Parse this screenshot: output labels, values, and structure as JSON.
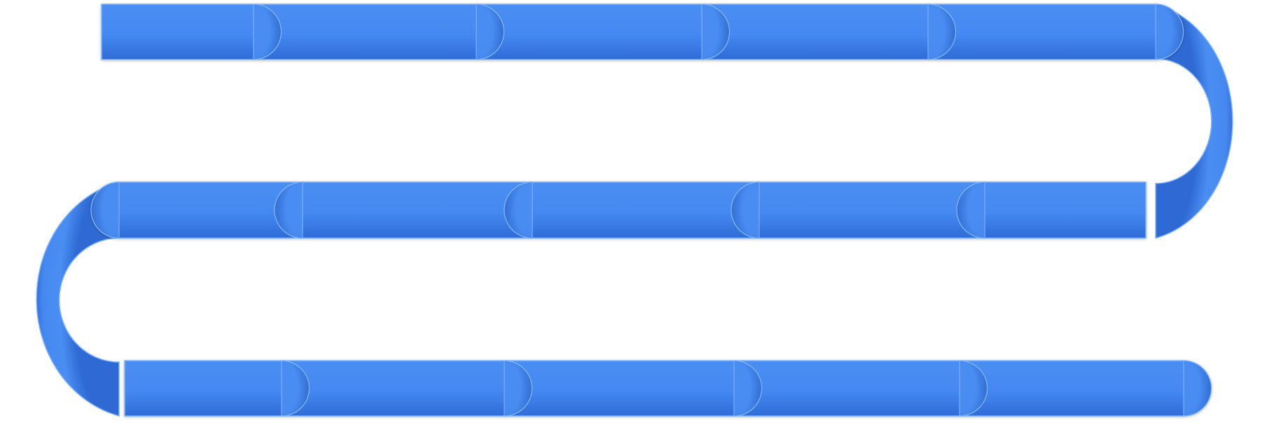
{
  "diagram": {
    "kind": "serpentine-segmented-path",
    "rows": [
      {
        "segments": 5,
        "direction": "left-to-right",
        "start_cap": "flat",
        "end_cap": "round"
      },
      {
        "segments": 5,
        "direction": "right-to-left",
        "start_cap": "flat",
        "end_cap": "round"
      },
      {
        "segments": 5,
        "direction": "left-to-right",
        "start_cap": "flat",
        "end_cap": "round"
      }
    ],
    "connectors": [
      {
        "between_rows": [
          1,
          2
        ],
        "side": "right"
      },
      {
        "between_rows": [
          2,
          3
        ],
        "side": "left"
      }
    ],
    "text_labels": []
  },
  "colors": {
    "fill_light": "#4a8ef3",
    "fill_mid": "#4487f0",
    "fill_dark": "#2f6bd6",
    "stroke": "#7fb4ff",
    "shadow": "#1d4fae"
  }
}
